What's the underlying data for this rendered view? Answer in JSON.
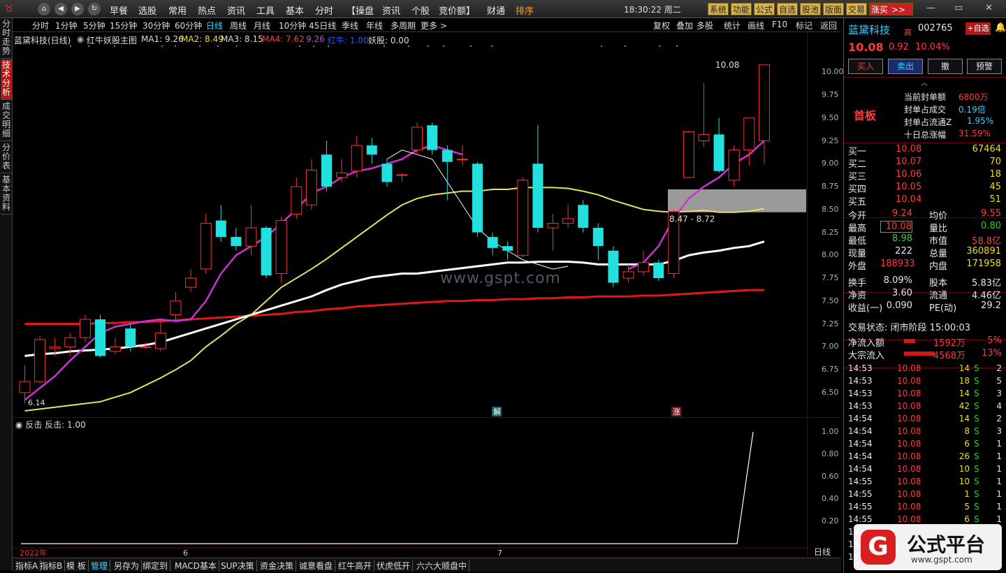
{
  "topbar": {
    "menus": [
      "早餐",
      "选股",
      "常用",
      "热点",
      "资讯",
      "工具",
      "基本",
      "分时",
      "【操盘",
      "资讯",
      "个股",
      "竞价额】",
      "财通",
      "排序"
    ],
    "clock": "18:30:22 周二",
    "buttons": [
      "系统",
      "功能",
      "公式",
      "自选",
      "股池",
      "版面",
      "交易",
      "涨买"
    ]
  },
  "lefttabs": [
    "分时走势",
    "技术分析",
    "成交明细",
    "分价表",
    "基本资料"
  ],
  "periods": [
    "分时",
    "1分钟",
    "5分钟",
    "15分钟",
    "30分钟",
    "60分钟",
    "日线",
    "周线",
    "月线",
    "10分钟",
    "45日线",
    "季线",
    "年线",
    "多周期",
    "更多 >"
  ],
  "righttools": [
    "复权",
    "叠加",
    "多股",
    "统计",
    "画线",
    "F10",
    "标记",
    "返回"
  ],
  "infobar": {
    "name": "蓝黛科技(日线)",
    "formula": "红牛妖股主图",
    "ma1": "MA1: 9.26",
    "ma2": "MA2: 8.49",
    "ma3": "MA3: 8.15",
    "ma4": "MA4: 7.62",
    "v5": "9.26",
    "v6": "红牛: 1.00",
    "v7": "妖股: 0.00"
  },
  "chart_data": {
    "type": "candlestick",
    "ylim": [
      6.3,
      10.3
    ],
    "yticks": [
      "10.00",
      "9.75",
      "9.50",
      "9.25",
      "9.00",
      "8.75",
      "8.50",
      "8.25",
      "8.00",
      "7.75",
      "7.50",
      "7.25",
      "7.00",
      "6.75",
      "6.50"
    ],
    "candles": [
      [
        6.5,
        6.62,
        6.8,
        6.38
      ],
      [
        6.62,
        7.08,
        7.12,
        6.6
      ],
      [
        6.98,
        7.0,
        7.1,
        6.9
      ],
      [
        7.0,
        7.1,
        7.15,
        6.9
      ],
      [
        7.1,
        7.3,
        7.35,
        7.05
      ],
      [
        7.3,
        6.9,
        7.35,
        6.88
      ],
      [
        6.95,
        7.0,
        7.1,
        6.92
      ],
      [
        7.2,
        7.0,
        7.25,
        6.95
      ],
      [
        7.0,
        7.0,
        7.05,
        6.98
      ],
      [
        6.98,
        7.15,
        7.3,
        6.95
      ],
      [
        7.35,
        7.5,
        7.6,
        7.3
      ],
      [
        7.65,
        7.75,
        7.85,
        7.6
      ],
      [
        7.85,
        8.35,
        8.45,
        7.8
      ],
      [
        8.38,
        8.2,
        8.55,
        8.15
      ],
      [
        8.2,
        8.1,
        8.3,
        8.05
      ],
      [
        8.1,
        8.3,
        8.55,
        8.0
      ],
      [
        8.3,
        7.78,
        8.32,
        7.75
      ],
      [
        7.8,
        8.38,
        8.42,
        7.7
      ],
      [
        8.45,
        8.75,
        8.85,
        8.4
      ],
      [
        8.55,
        8.93,
        9.05,
        8.5
      ],
      [
        9.1,
        8.75,
        9.25,
        8.7
      ],
      [
        8.85,
        8.9,
        9.05,
        8.8
      ],
      [
        8.92,
        9.2,
        9.3,
        8.85
      ],
      [
        9.2,
        9.1,
        9.28,
        9.0
      ],
      [
        9.0,
        8.8,
        9.05,
        8.75
      ],
      [
        8.88,
        8.88,
        8.9,
        8.8
      ],
      [
        9.15,
        9.4,
        9.45,
        9.1
      ],
      [
        9.42,
        9.15,
        9.45,
        9.1
      ],
      [
        9.15,
        9.02,
        9.2,
        8.6
      ],
      [
        9.05,
        9.05,
        9.2,
        8.98
      ],
      [
        9.0,
        8.25,
        9.02,
        8.2
      ],
      [
        8.2,
        8.08,
        8.25,
        8.0
      ],
      [
        8.1,
        8.05,
        8.15,
        7.95
      ],
      [
        8.0,
        8.82,
        8.85,
        7.98
      ],
      [
        9.0,
        8.3,
        9.42,
        8.25
      ],
      [
        8.3,
        8.35,
        8.45,
        8.05
      ],
      [
        8.35,
        8.4,
        8.55,
        8.3
      ],
      [
        8.55,
        8.3,
        8.6,
        8.25
      ],
      [
        8.3,
        8.1,
        8.35,
        7.95
      ],
      [
        8.05,
        7.7,
        8.1,
        7.65
      ],
      [
        7.75,
        7.82,
        7.9,
        7.7
      ],
      [
        7.82,
        7.92,
        8.05,
        7.78
      ],
      [
        7.92,
        7.75,
        7.95,
        7.72
      ],
      [
        7.8,
        8.48,
        8.5,
        7.75
      ],
      [
        8.85,
        9.35,
        9.35,
        8.85
      ],
      [
        9.25,
        9.32,
        9.88,
        9.18
      ],
      [
        9.32,
        8.92,
        9.5,
        8.9
      ],
      [
        8.82,
        9.15,
        9.2,
        8.75
      ],
      [
        9.15,
        9.5,
        9.5,
        8.98
      ],
      [
        9.25,
        10.08,
        10.08,
        9.0
      ]
    ],
    "ma_white": [
      6.9,
      6.92,
      6.93,
      6.95,
      6.96,
      6.97,
      6.98,
      7.0,
      7.02,
      7.05,
      7.1,
      7.15,
      7.2,
      7.25,
      7.3,
      7.35,
      7.4,
      7.45,
      7.5,
      7.55,
      7.62,
      7.68,
      7.72,
      7.76,
      7.78,
      7.8,
      7.8,
      7.82,
      7.84,
      7.86,
      7.88,
      7.9,
      7.92,
      7.92,
      7.93,
      7.93,
      7.93,
      7.92,
      7.9,
      7.9,
      7.9,
      7.9,
      7.9,
      7.94,
      8.0,
      8.03,
      8.05,
      8.08,
      8.1,
      8.15
    ],
    "ma_yellow": [
      6.3,
      6.32,
      6.34,
      6.36,
      6.38,
      6.4,
      6.45,
      6.5,
      6.58,
      6.66,
      6.75,
      6.85,
      7.0,
      7.12,
      7.25,
      7.35,
      7.5,
      7.65,
      7.75,
      7.85,
      7.96,
      8.08,
      8.2,
      8.32,
      8.44,
      8.55,
      8.62,
      8.66,
      8.68,
      8.7,
      8.7,
      8.72,
      8.72,
      8.74,
      8.74,
      8.74,
      8.73,
      8.7,
      8.66,
      8.6,
      8.55,
      8.5,
      8.48,
      8.47,
      8.48,
      8.49,
      8.47,
      8.47,
      8.48,
      8.51
    ],
    "ma_red": [
      7.25,
      7.25,
      7.25,
      7.25,
      7.25,
      7.26,
      7.26,
      7.27,
      7.27,
      7.28,
      7.29,
      7.3,
      7.31,
      7.32,
      7.33,
      7.34,
      7.35,
      7.36,
      7.38,
      7.39,
      7.41,
      7.42,
      7.44,
      7.45,
      7.46,
      7.47,
      7.48,
      7.49,
      7.5,
      7.5,
      7.51,
      7.51,
      7.52,
      7.52,
      7.53,
      7.53,
      7.54,
      7.54,
      7.55,
      7.55,
      7.55,
      7.56,
      7.56,
      7.57,
      7.58,
      7.59,
      7.6,
      7.61,
      7.62,
      7.62
    ],
    "ma_magenta": [
      6.42,
      6.55,
      6.68,
      6.85,
      7.0,
      7.15,
      7.22,
      7.25,
      7.28,
      7.3,
      7.28,
      7.3,
      7.5,
      7.8,
      8.0,
      8.1,
      8.2,
      8.35,
      8.5,
      8.68,
      8.75,
      8.85,
      8.92,
      8.95,
      9.0,
      9.05,
      9.15,
      9.2,
      9.15,
      9.1
    ],
    "ma_thin": [
      [
        9.05,
        9.08
      ],
      [
        9.15,
        9.12
      ],
      [
        9.2,
        9.0
      ],
      [
        9.0,
        8.75
      ],
      [
        8.6,
        8.5
      ],
      [
        8.35,
        8.2
      ],
      [
        8.1,
        8.0
      ],
      [
        7.9,
        7.85
      ],
      [
        7.88,
        7.8
      ]
    ],
    "labels": {
      "high": "10.08",
      "low": "6.14",
      "zone": "8.47 - 8.72",
      "sig1": "解",
      "sig2": "涨",
      "watermark": "www.gspt.com"
    }
  },
  "subchart": {
    "title": "反击",
    "value": "反击: 1.00",
    "yticks": [
      "1.00",
      "0.80",
      "0.60",
      "0.40",
      "0.20"
    ],
    "xlabels": [
      "2022年",
      "6",
      "7"
    ],
    "period": "日线"
  },
  "bottomtabs": [
    "指标A",
    "指标B",
    "模 板",
    "管理",
    "另存为",
    "绑定到",
    "MACD基本",
    "SUP决策",
    "资金决策",
    "诚意看盘",
    "红牛高开",
    "伏虎低开",
    "六六大顺盘中"
  ],
  "rpanel": {
    "name": "蓝黛科技",
    "tag": "高",
    "code": "002765",
    "addfav": "+自选",
    "price": "10.08",
    "chg": "0.92",
    "pct": "10.04%",
    "buy": "买入",
    "sell": "卖出",
    "cancel": "撤",
    "alert": "预警",
    "board": "首板",
    "seal": [
      {
        "k": "当前封单额",
        "v": "6800万",
        "c": "red"
      },
      {
        "k": "封单占成交",
        "v": "0.19倍",
        "c": "cyn"
      },
      {
        "k": "封单占流通Z",
        "v": "1.95%",
        "c": "cyn"
      },
      {
        "k": "十日总涨幅",
        "v": "31.59%",
        "c": "red"
      }
    ],
    "orders": [
      {
        "k": "买一",
        "p": "10.08",
        "v": "67464"
      },
      {
        "k": "买二",
        "p": "10.07",
        "v": "70"
      },
      {
        "k": "买三",
        "p": "10.06",
        "v": "18"
      },
      {
        "k": "买四",
        "p": "10.05",
        "v": "45"
      },
      {
        "k": "买五",
        "p": "10.04",
        "v": "51"
      }
    ],
    "stats": [
      [
        "今开",
        "9.24",
        "均价",
        "9.55"
      ],
      [
        "最高",
        "10.08",
        "量比",
        "0.80"
      ],
      [
        "最低",
        "8.98",
        "市值",
        "58.8亿"
      ],
      [
        "现量",
        "222",
        "总量",
        "360891"
      ],
      [
        "外盘",
        "188933",
        "内盘",
        "171958"
      ]
    ],
    "stats2": [
      [
        "换手",
        "8.09%",
        "股本",
        "5.83亿"
      ],
      [
        "净资",
        "3.60",
        "流通",
        "4.46亿"
      ],
      [
        "收益(一)",
        "0.090",
        "PE(动)",
        "29.2"
      ]
    ],
    "status": "交易状态: 闭市阶段 15:00:03",
    "flow": [
      {
        "k": "净流入额",
        "v": "1592万",
        "p": "5%"
      },
      {
        "k": "大宗流入",
        "v": "4568万",
        "p": "13%"
      }
    ],
    "ticks": [
      [
        "14:53",
        "10.08",
        "14",
        "S",
        "2"
      ],
      [
        "14:53",
        "10.08",
        "18",
        "S",
        "5"
      ],
      [
        "14:53",
        "10.08",
        "14",
        "S",
        "3"
      ],
      [
        "14:53",
        "10.08",
        "42",
        "S",
        "4"
      ],
      [
        "14:54",
        "10.08",
        "14",
        "S",
        "2"
      ],
      [
        "14:54",
        "10.08",
        "8",
        "S",
        "3"
      ],
      [
        "14:54",
        "10.08",
        "6",
        "S",
        "1"
      ],
      [
        "14:54",
        "10.08",
        "26",
        "S",
        "1"
      ],
      [
        "14:54",
        "10.08",
        "10",
        "S",
        "1"
      ],
      [
        "14:55",
        "10.08",
        "10",
        "S",
        "1"
      ],
      [
        "14:55",
        "10.08",
        "1",
        "S",
        "1"
      ],
      [
        "14:55",
        "10.08",
        "5",
        "S",
        "1"
      ],
      [
        "14:55",
        "10.08",
        "6",
        "S",
        "1"
      ]
    ],
    "badge": "公式平台",
    "badgeurl": "www.gspt.com"
  }
}
